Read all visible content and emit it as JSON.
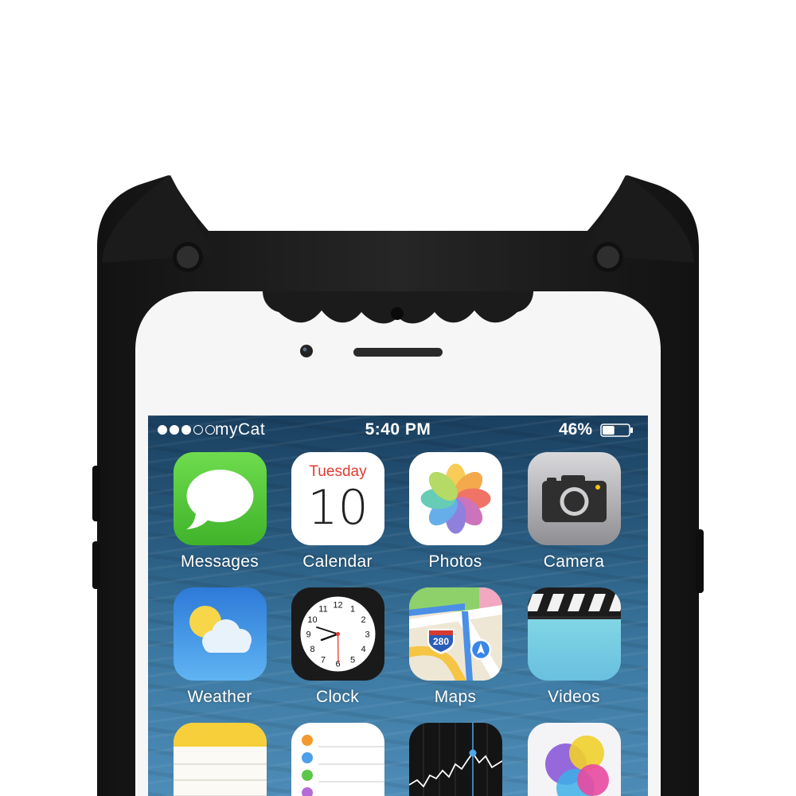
{
  "status_bar": {
    "carrier": "myCat",
    "time": "5:40 PM",
    "battery": "46%",
    "battery_level": 0.46,
    "signal_bars_filled": 3,
    "signal_bars_total": 5
  },
  "calendar": {
    "weekday": "Tuesday",
    "day": "10"
  },
  "maps": {
    "shield": "280"
  },
  "clock": {
    "numbers": [
      "12",
      "1",
      "2",
      "3",
      "4",
      "5",
      "6",
      "7",
      "8",
      "9",
      "10",
      "11"
    ]
  },
  "apps": [
    {
      "label": "Messages",
      "icon": "messages-icon"
    },
    {
      "label": "Calendar",
      "icon": "calendar-icon"
    },
    {
      "label": "Photos",
      "icon": "photos-icon"
    },
    {
      "label": "Camera",
      "icon": "camera-icon"
    },
    {
      "label": "Weather",
      "icon": "weather-icon"
    },
    {
      "label": "Clock",
      "icon": "clock-icon"
    },
    {
      "label": "Maps",
      "icon": "maps-icon"
    },
    {
      "label": "Videos",
      "icon": "videos-icon"
    },
    {
      "label": "",
      "icon": "notes-icon"
    },
    {
      "label": "",
      "icon": "reminders-icon"
    },
    {
      "label": "",
      "icon": "stocks-icon"
    },
    {
      "label": "",
      "icon": "game-center-icon"
    }
  ],
  "colors": {
    "case": "#1e1e1e",
    "messages": "#5cc83a",
    "calendar_red": "#e33a2f",
    "weather": "#3a8ee6",
    "videos": "#7cd0e0"
  }
}
